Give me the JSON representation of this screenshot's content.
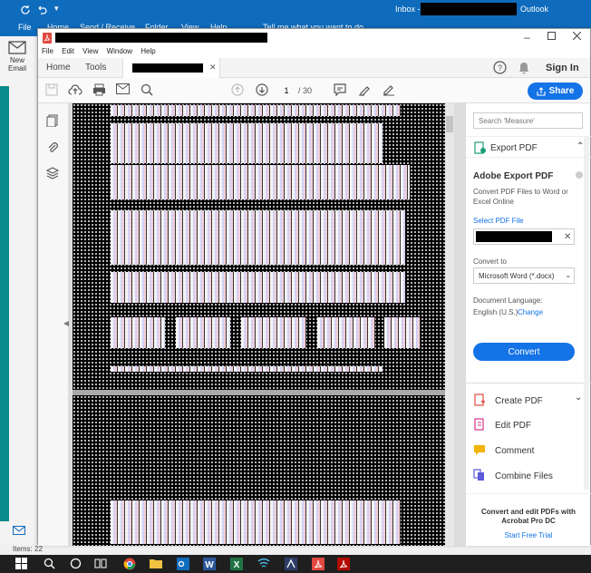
{
  "outlook": {
    "title": "Inbox -",
    "app_name": "Outlook",
    "ribbon_tabs": [
      "File",
      "Home",
      "Send / Receive",
      "Folder",
      "View",
      "Help"
    ],
    "tell_me": "Tell me what you want to do",
    "new_email_label_1": "New",
    "new_email_label_2": "Email",
    "status_items": "Items: 22"
  },
  "acrobat": {
    "menu": [
      "File",
      "Edit",
      "View",
      "Window",
      "Help"
    ],
    "tabs": {
      "home": "Home",
      "tools": "Tools"
    },
    "sign_in": "Sign In",
    "share": "Share",
    "page_current": "1",
    "page_total": "/ 30"
  },
  "right_panel": {
    "search_placeholder": "Search 'Measure'",
    "export_pdf": "Export PDF",
    "adobe_export_title": "Adobe Export PDF",
    "export_desc": "Convert PDF Files to Word or Excel Online",
    "select_pdf_file": "Select PDF File",
    "convert_to": "Convert to",
    "convert_format": "Microsoft Word (*.docx)",
    "doc_language_label": "Document Language:",
    "doc_language_value": "English (U.S.)",
    "change": "Change",
    "convert_button": "Convert",
    "tools": [
      {
        "label": "Create PDF",
        "icon": "create-pdf-icon",
        "color": "#e0493f"
      },
      {
        "label": "Edit PDF",
        "icon": "edit-pdf-icon",
        "color": "#d6338f"
      },
      {
        "label": "Comment",
        "icon": "comment-icon",
        "color": "#f2b400"
      },
      {
        "label": "Combine Files",
        "icon": "combine-files-icon",
        "color": "#5a5adb"
      }
    ],
    "promo_title": "Convert and edit PDFs with Acrobat Pro DC",
    "free_trial": "Start Free Trial"
  },
  "colors": {
    "outlook_blue": "#0f6cbd",
    "acrobat_blue": "#1473e6",
    "teal": "#0a8a8a",
    "acrobat_red": "#e0493f"
  }
}
